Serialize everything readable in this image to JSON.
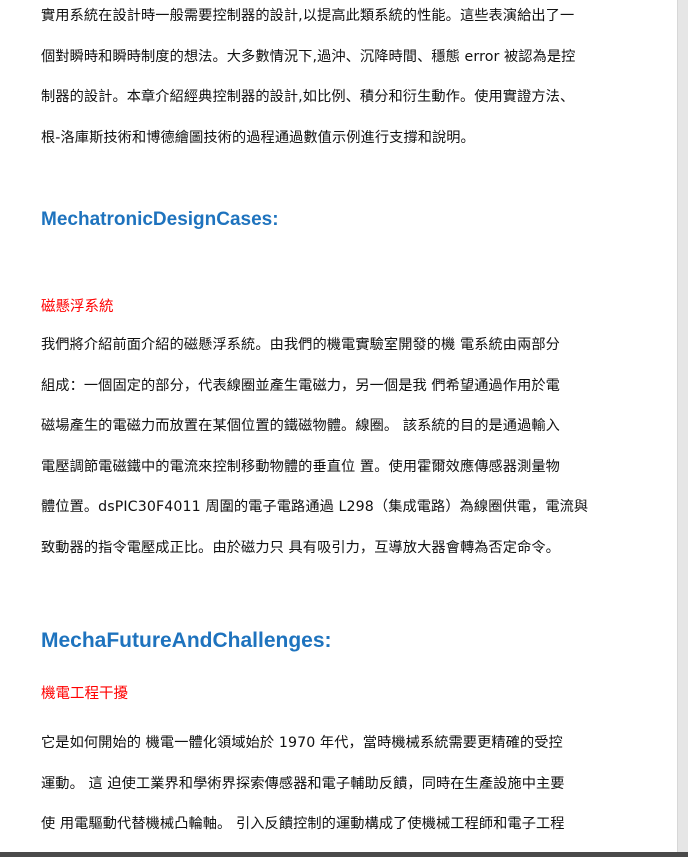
{
  "section1": {
    "lines": [
      "實用系統在設計時一般需要控制器的設計,以提高此類系統的性能。這些表演給出了一",
      "個對瞬時和瞬時制度的想法。大多數情況下,過沖、沉降時間、穩態 error 被認為是控",
      "制器的設計。本章介紹經典控制器的設計,如比例、積分和衍生動作。使用實證方法、",
      "根-洛庫斯技術和博德繪圖技術的過程通過數值示例進行支撐和說明。"
    ]
  },
  "heading1": "MechatronicDesignCases:",
  "subheading1": "磁懸浮系統",
  "section2": {
    "lines": [
      "我們將介紹前面介紹的磁懸浮系統。由我們的機電實驗室開發的機 電系統由兩部分",
      "組成：一個固定的部分，代表線圈並產生電磁力，另一個是我 們希望通過作用於電",
      "磁場產生的電磁力而放置在某個位置的鐵磁物體。線圈。 該系統的目的是通過輸入",
      "電壓調節電磁鐵中的電流來控制移動物體的垂直位 置。使用霍爾效應傳感器測量物",
      "體位置。dsPIC30F4011 周圍的電子電路通過 L298（集成電路）為線圈供電，電流與",
      "致動器的指令電壓成正比。由於磁力只 具有吸引力，互導放大器會轉為否定命令。"
    ]
  },
  "heading2": "MechaFutureAndChallenges:",
  "subheading2": "機電工程干擾",
  "section3": {
    "lines": [
      "它是如何開始的 機電一體化領域始於 1970 年代，當時機械系統需要更精確的受控",
      "運動。 這 迫使工業界和學術界探索傳感器和電子輔助反饋，同時在生產設施中主要",
      "使 用電驅動代替機械凸輪軸。 引入反饋控制的運動構成了使機械工程師和電子工程"
    ]
  }
}
